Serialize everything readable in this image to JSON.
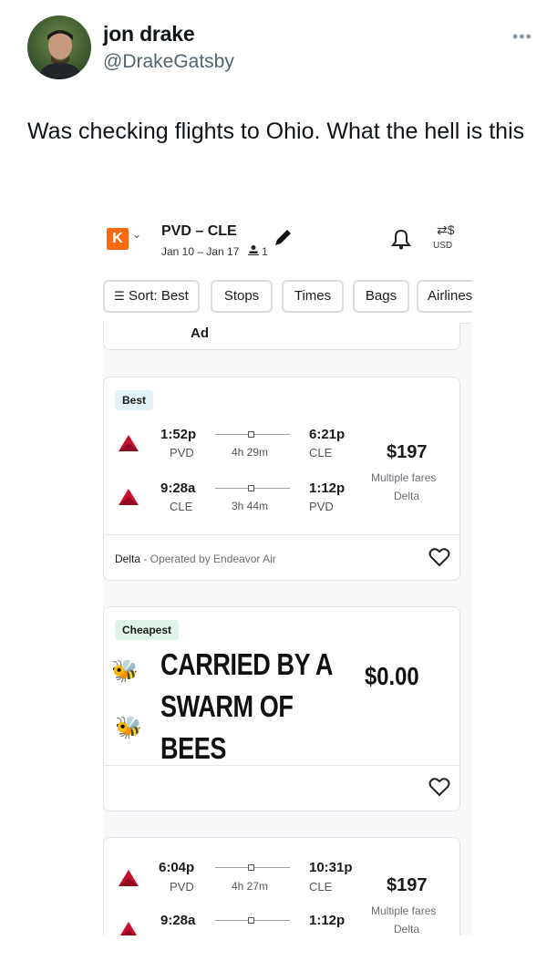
{
  "tweet": {
    "display_name": "jon drake",
    "handle": "@DrakeGatsby",
    "more_icon": "more-dots-icon",
    "text": "Was checking flights to Ohio. What the hell is this"
  },
  "app": {
    "logo_letter": "K",
    "route": "PVD – CLE",
    "dates": "Jan 10 – Jan 17",
    "travelers": "1",
    "currency": "USD",
    "brand_color": "#ff690f",
    "delta_red": "#c8102e"
  },
  "filters": {
    "sort": "Sort: Best",
    "stops": "Stops",
    "times": "Times",
    "bags": "Bags",
    "airlines": "Airlines"
  },
  "ad_label": "Ad",
  "best_card": {
    "badge": "Best",
    "outbound": {
      "depart": "1:52p",
      "from": "PVD",
      "duration": "4h 29m",
      "arrive": "6:21p",
      "to": "CLE"
    },
    "return": {
      "depart": "9:28a",
      "from": "CLE",
      "duration": "3h 44m",
      "arrive": "1:12p",
      "to": "PVD"
    },
    "price": "$197",
    "fares": "Multiple fares",
    "airline": "Delta",
    "operated_airline": "Delta",
    "operated_by": " - Operated by Endeavor Air"
  },
  "cheap_card": {
    "badge": "Cheapest",
    "line1": "CARRIED BY A",
    "line2": "SWARM OF",
    "line3": "BEES",
    "price": "$0.00",
    "bee1": "🐝",
    "bee2": "🐝"
  },
  "third_card": {
    "outbound": {
      "depart": "6:04p",
      "from": "PVD",
      "duration": "4h 27m",
      "arrive": "10:31p",
      "to": "CLE"
    },
    "return": {
      "depart": "9:28a",
      "arrive": "1:12p"
    },
    "price": "$197",
    "fares": "Multiple fares",
    "airline": "Delta"
  }
}
